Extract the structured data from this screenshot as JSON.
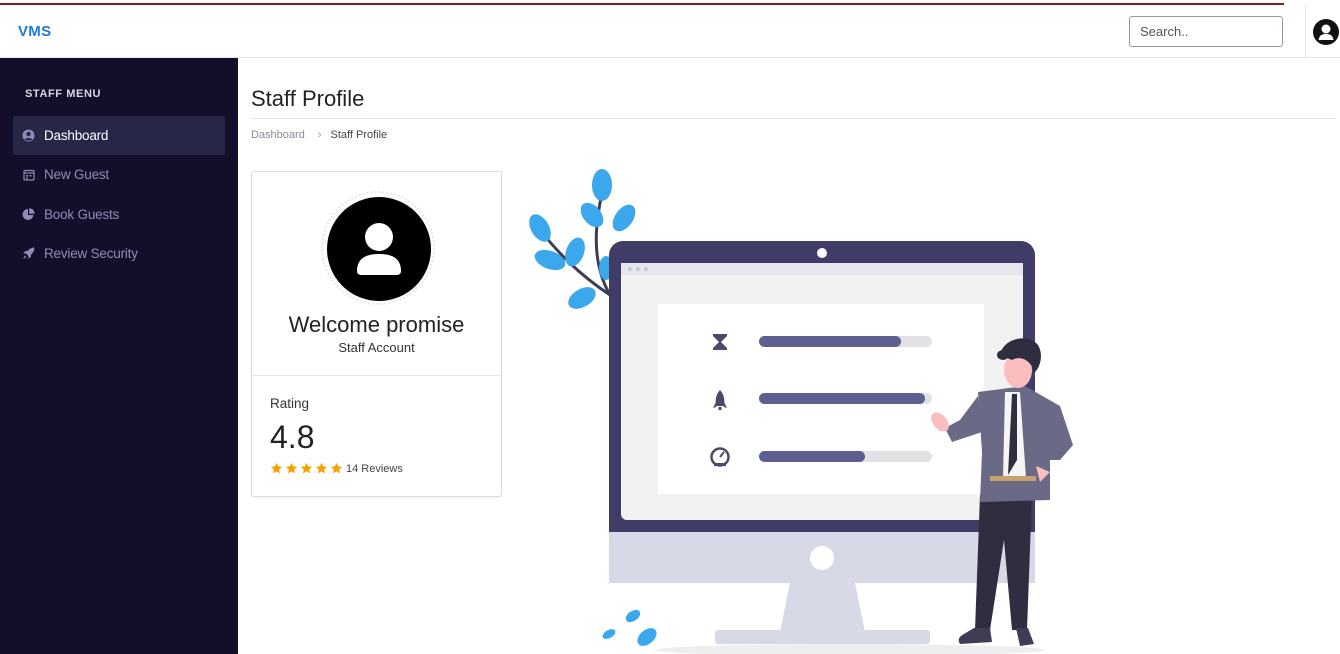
{
  "header": {
    "brand": "VMS",
    "search_placeholder": "Search.."
  },
  "sidebar": {
    "title": "STAFF MENU",
    "items": [
      {
        "label": "Dashboard",
        "icon": "user-circle-icon",
        "active": true
      },
      {
        "label": "New Guest",
        "icon": "calendar-icon",
        "active": false
      },
      {
        "label": "Book Guests",
        "icon": "pie-chart-icon",
        "active": false
      },
      {
        "label": "Review Security",
        "icon": "rocket-icon",
        "active": false
      }
    ]
  },
  "page": {
    "title": "Staff Profile",
    "breadcrumb": {
      "parent": "Dashboard",
      "current": "Staff Profile"
    }
  },
  "profile": {
    "welcome": "Welcome promise",
    "account_type": "Staff Account",
    "rating_label": "Rating",
    "rating_value": "4.8",
    "stars": 5,
    "reviews": "14 Reviews"
  },
  "illustration": {
    "progress": [
      0.82,
      0.96,
      0.61
    ]
  },
  "colors": {
    "sidebar_bg": "#130f2b",
    "brand": "#1e7ad6",
    "star": "#f5a100",
    "illustration_bar": "#5d5f91"
  }
}
